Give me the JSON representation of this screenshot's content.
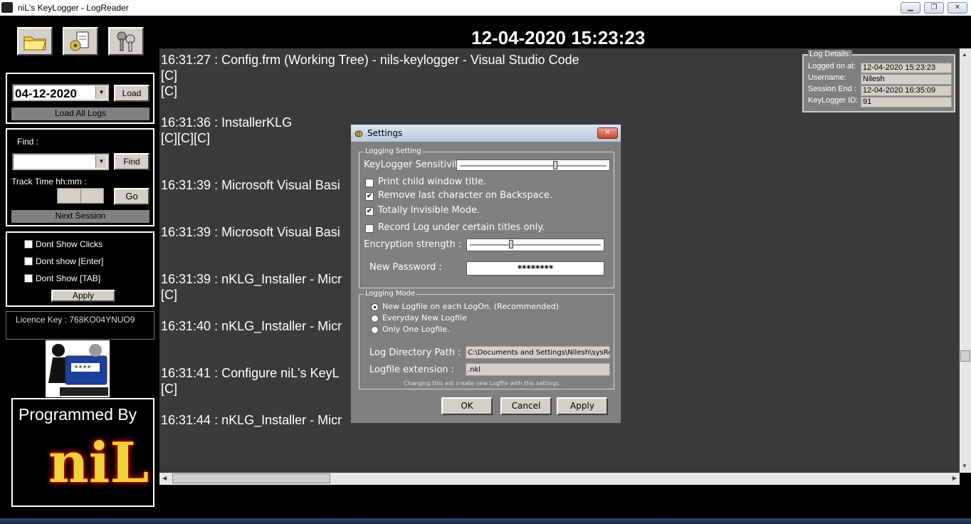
{
  "window": {
    "title": "niL's KeyLogger  -  LogReader",
    "minimize": "▁",
    "restore": "❐",
    "close": "✕"
  },
  "header": {
    "datetime": "12-04-2020  15:23:23"
  },
  "sidebar": {
    "date_value": "04-12-2020",
    "load_label": "Load",
    "load_all_label": "Load All Logs",
    "find_label": "Find :",
    "find_button": "Find",
    "track_time_label": "Track Time hh:mm :",
    "go_label": "Go",
    "next_session_label": "Next Session",
    "dont_show_clicks": "Dont Show Clicks",
    "dont_show_enter": "Dont show [Enter]",
    "dont_show_tab": "Dont Show [TAB]",
    "apply_label": "Apply",
    "licence_key": "Licence Key : 768KO04YNUO9",
    "programmed_by": "Programmed By",
    "author": "niL"
  },
  "log": {
    "lines": [
      "16:31:27 : Config.frm (Working Tree) - nils-keylogger - Visual Studio Code",
      "[C]",
      "[C]",
      "16:31:36 : InstallerKLG",
      "[C][C][C]",
      "16:31:39 : Microsoft Visual Basi",
      "16:31:39 : Microsoft Visual Basi",
      "16:31:39 : nKLG_Installer - Micr",
      "[C]",
      "16:31:40 : nKLG_Installer - Micr",
      "16:31:41 : Configure niL's KeyL",
      "[C]",
      "16:31:44 : nKLG_Installer - Micr"
    ]
  },
  "details": {
    "legend": "Log Details:",
    "logged_on_label": "Logged on at:",
    "logged_on_value": "12-04-2020  15:23:23",
    "username_label": "Username:",
    "username_value": "Nilesh",
    "session_end_label": "Session End :",
    "session_end_value": "12-04-2020 16:35:09",
    "keylogger_id_label": "KeyLogger ID:",
    "keylogger_id_value": "91"
  },
  "settings": {
    "title": "Settings",
    "logging_setting_legend": "Logging Setting",
    "sensitivity_label": "KeyLogger Sensitivity",
    "sensitivity_level": 0.64,
    "print_child": "Print child window title.",
    "print_child_checked": false,
    "remove_backspace": "Remove last character on Backspace.",
    "remove_backspace_checked": true,
    "invisible": "Totally Invisible Mode.",
    "invisible_checked": true,
    "record_titles": "Record Log under certain titles only.",
    "record_titles_checked": false,
    "encryption_label": "Encryption strength :",
    "encryption_level": 0.3,
    "password_label": "New Password :",
    "password_value": "********",
    "logging_mode_legend": "Logging Mode",
    "mode_each_logon": "New Logfile on each LogOn. (Recommended)",
    "mode_everyday": "Everyday New Logfile",
    "mode_one": "Only One Logfile.",
    "log_dir_label": "Log Directory Path :",
    "log_dir_value": "C:\\Documents and Settings\\Nilesh\\sysRes",
    "ext_label": "Logfile extension :",
    "ext_value": ".nkl",
    "note": "Changing this will create new Logfile with this settings.",
    "ok_label": "OK",
    "cancel_label": "Cancel",
    "apply_label": "Apply"
  },
  "colors": {
    "log_background": "#3a3a3a",
    "dialog_background": "#808080",
    "app_background": "#000000"
  }
}
